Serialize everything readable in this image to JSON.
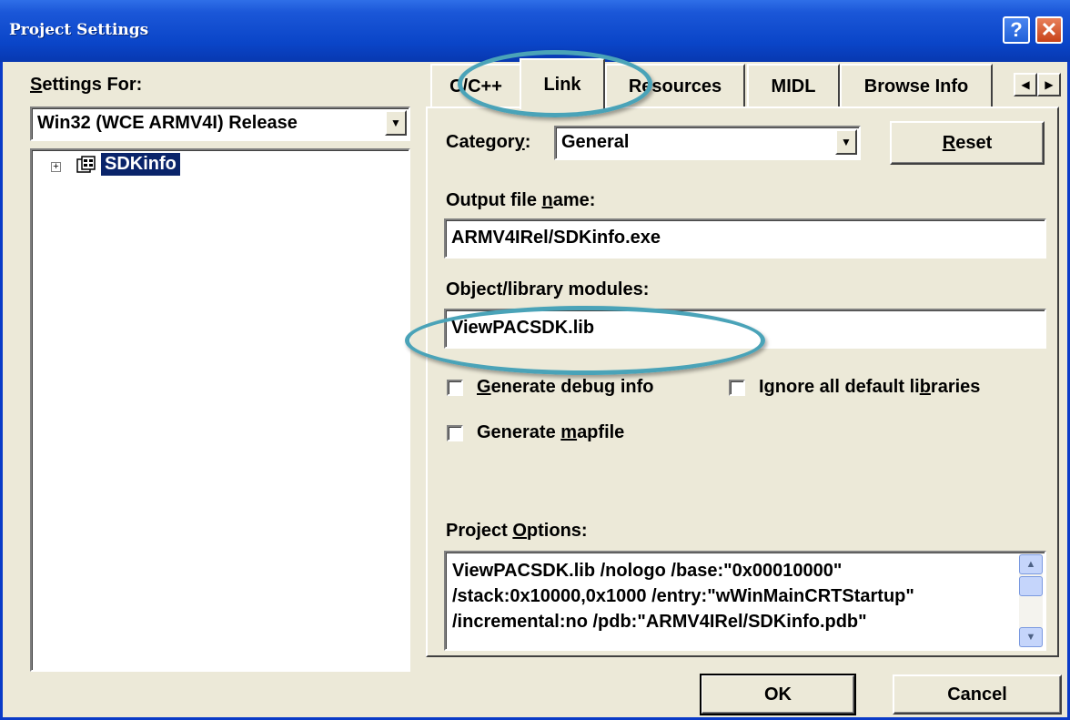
{
  "window": {
    "title": "Project Settings",
    "help_label": "?",
    "close_label": "✕"
  },
  "left": {
    "settings_for_prefix": "S",
    "settings_for_rest": "ettings For:",
    "config_value": "Win32 (WCE ARMV4I) Release",
    "tree": {
      "expander": "+",
      "project_label": "SDKinfo"
    }
  },
  "tabs": [
    {
      "label": "C/C++"
    },
    {
      "label": "Link"
    },
    {
      "label": "Resources"
    },
    {
      "label": "MIDL"
    },
    {
      "label": "Browse Info"
    }
  ],
  "tab_scroll": {
    "left": "◀",
    "right": "▶"
  },
  "link": {
    "category_pre": "Categor",
    "category_u": "y",
    "category_post": ":",
    "category_value": "General",
    "reset_pre": "",
    "reset_u": "R",
    "reset_post": "eset",
    "output_pre": "Output file ",
    "output_u": "n",
    "output_post": "ame:",
    "output_value": "ARMV4IRel/SDKinfo.exe",
    "objlib_label": "Object/library modules:",
    "objlib_value": "ViewPACSDK.lib",
    "debug_u": "G",
    "debug_post": "enerate debug info",
    "ignore_pre": "Ignore all default li",
    "ignore_u": "b",
    "ignore_post": "raries",
    "mapfile_pre": "Generate ",
    "mapfile_u": "m",
    "mapfile_post": "apfile",
    "options_pre": "Project ",
    "options_u": "O",
    "options_post": "ptions:",
    "options_lines": [
      "ViewPACSDK.lib /nologo /base:\"0x00010000\"",
      "/stack:0x10000,0x1000 /entry:\"wWinMainCRTStartup\"",
      "/incremental:no /pdb:\"ARMV4IRel/SDKinfo.pdb\""
    ]
  },
  "footer": {
    "ok_label": "OK",
    "cancel_label": "Cancel"
  },
  "annotations": {
    "color": "#4aa3b8"
  }
}
